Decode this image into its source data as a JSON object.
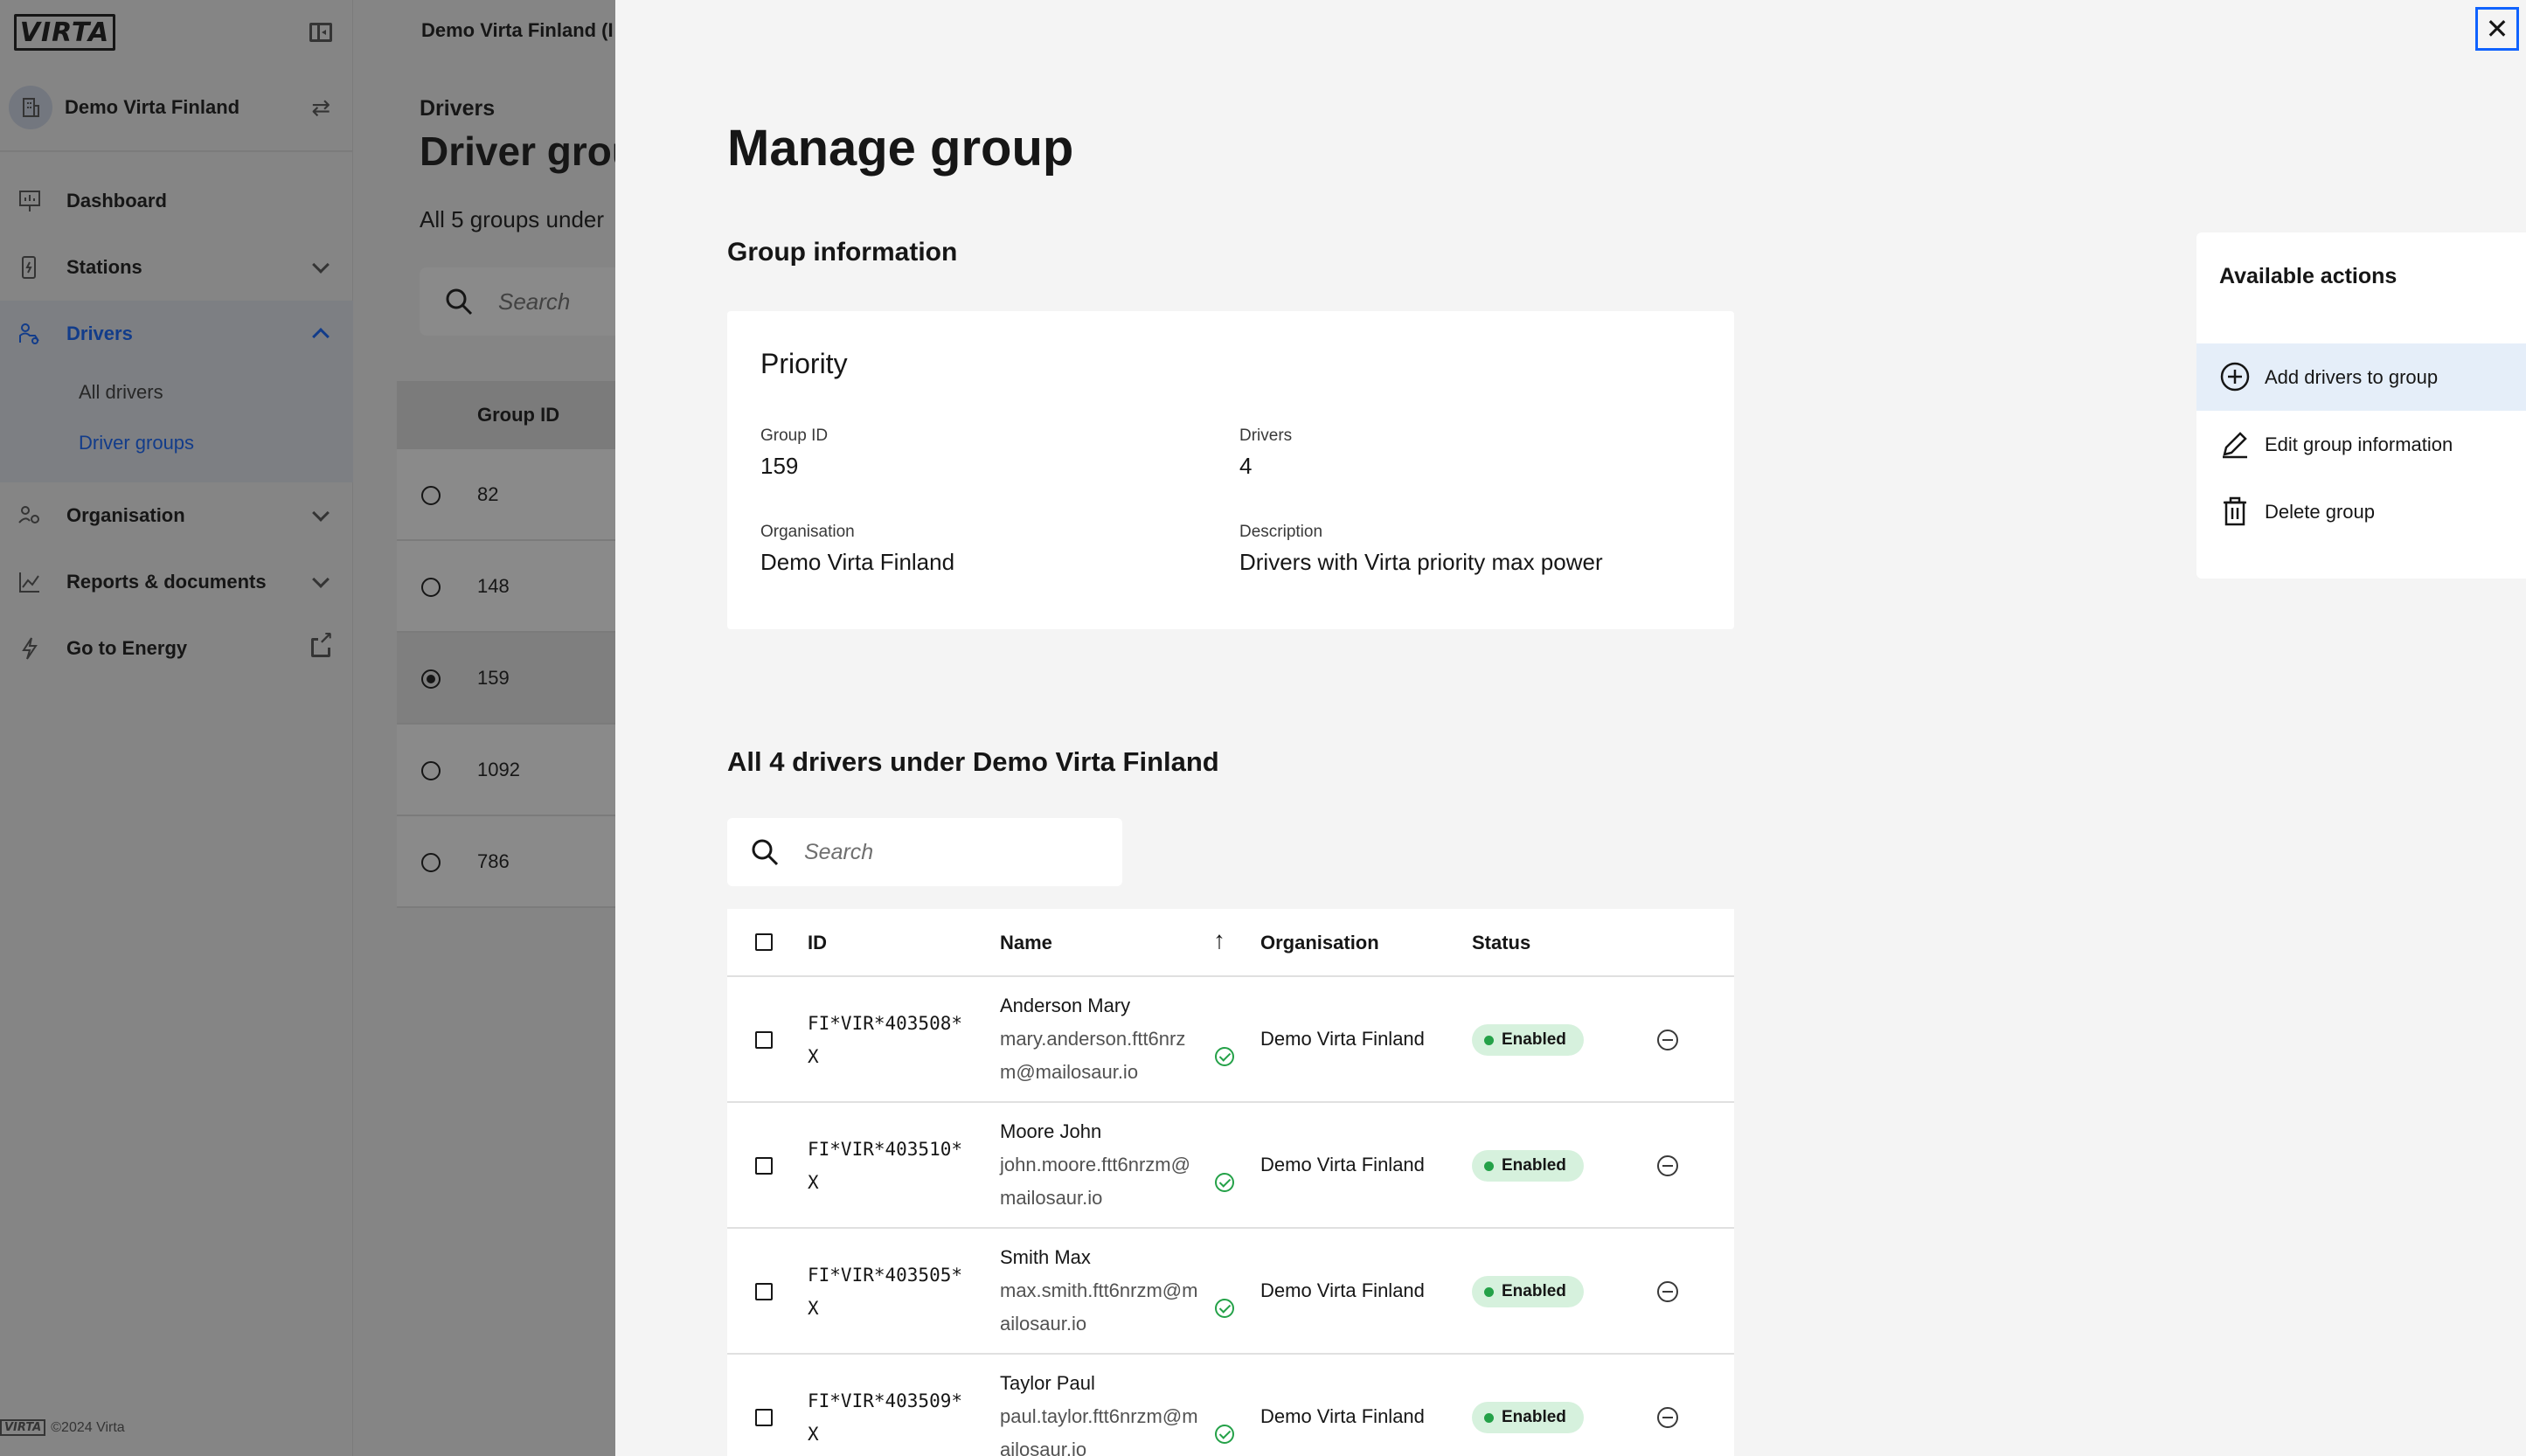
{
  "sidebar": {
    "logo_text": "VIRTA",
    "org_name": "Demo Virta Finland",
    "nav": [
      {
        "label": "Dashboard"
      },
      {
        "label": "Stations"
      },
      {
        "label": "Drivers"
      },
      {
        "label": "Organisation"
      },
      {
        "label": "Reports & documents"
      },
      {
        "label": "Go to Energy"
      }
    ],
    "drivers_sub": [
      "All drivers",
      "Driver groups"
    ],
    "footer_logo": "VIRTA",
    "footer_text": "©2024 Virta"
  },
  "background": {
    "top_org": "Demo Virta Finland (I",
    "breadcrumb": "Drivers",
    "title": "Driver grou",
    "subtitle": "All 5 groups under",
    "search_placeholder": "Search",
    "column_header": "Group ID",
    "rows": [
      "82",
      "148",
      "159",
      "1092",
      "786"
    ],
    "selected_row": "159"
  },
  "modal": {
    "title": "Manage group",
    "section_title": "Group information",
    "card": {
      "title": "Priority",
      "group_id_label": "Group ID",
      "group_id": "159",
      "drivers_label": "Drivers",
      "drivers": "4",
      "organisation_label": "Organisation",
      "organisation": "Demo Virta Finland",
      "description_label": "Description",
      "description": "Drivers with Virta priority max power"
    },
    "actions": {
      "title": "Available actions",
      "items": [
        "Add drivers to group",
        "Edit group information",
        "Delete group"
      ]
    },
    "drivers_title": "All 4 drivers under Demo Virta Finland",
    "search_placeholder": "Search",
    "table": {
      "headers": {
        "id": "ID",
        "name": "Name",
        "organisation": "Organisation",
        "status": "Status"
      },
      "rows": [
        {
          "id1": "FI*VIR*403508*",
          "id2": "X",
          "name": "Anderson Mary",
          "email": "mary.anderson.ftt6nrzm@mailosaur.io",
          "org": "Demo Virta Finland",
          "status": "Enabled"
        },
        {
          "id1": "FI*VIR*403510*",
          "id2": "X",
          "name": "Moore John",
          "email": "john.moore.ftt6nrzm@mailosaur.io",
          "org": "Demo Virta Finland",
          "status": "Enabled"
        },
        {
          "id1": "FI*VIR*403505*",
          "id2": "X",
          "name": "Smith Max",
          "email": "max.smith.ftt6nrzm@mailosaur.io",
          "org": "Demo Virta Finland",
          "status": "Enabled"
        },
        {
          "id1": "FI*VIR*403509*",
          "id2": "X",
          "name": "Taylor Paul",
          "email": "paul.taylor.ftt6nrzm@mailosaur.io",
          "org": "Demo Virta Finland",
          "status": "Enabled"
        }
      ]
    },
    "close_label": "✕"
  },
  "colors": {
    "accent": "#0f62fe",
    "success": "#24a148",
    "badge_bg": "#d6f1dd"
  }
}
